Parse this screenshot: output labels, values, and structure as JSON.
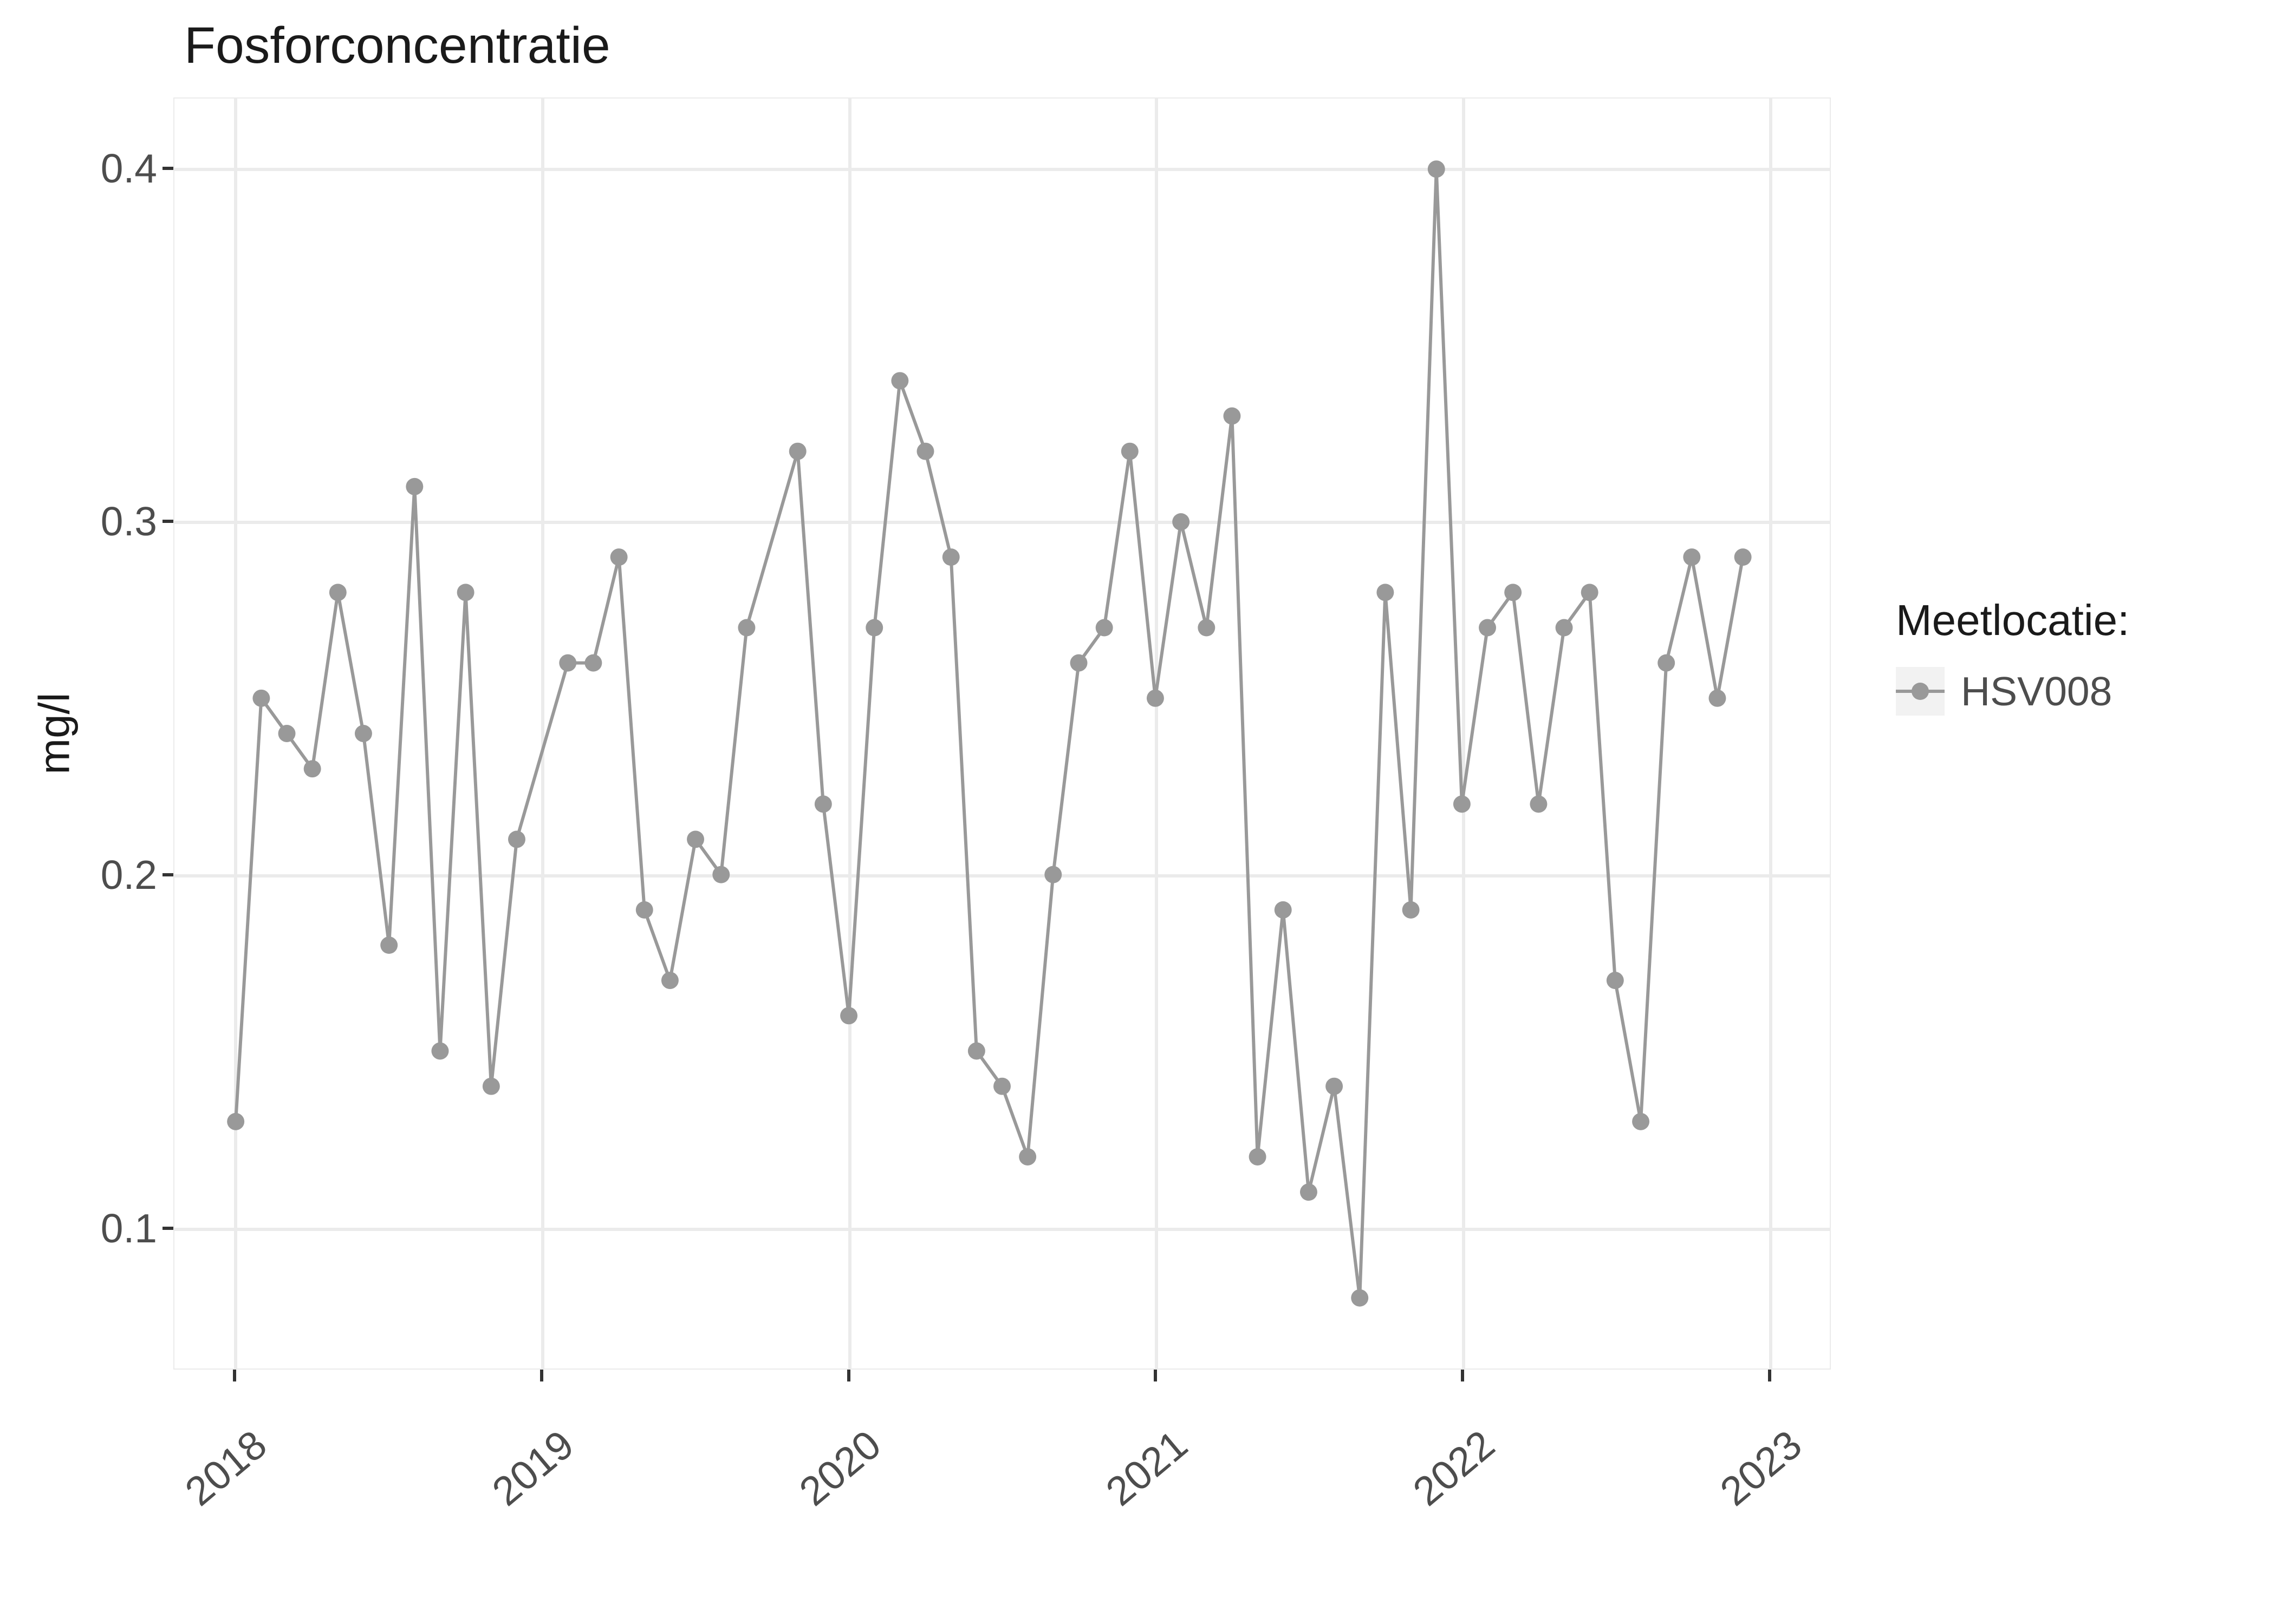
{
  "chart_data": {
    "type": "line",
    "title": "Fosforconcentratie",
    "xlabel": "",
    "ylabel": "mg/l",
    "xlim": [
      0,
      60
    ],
    "ylim": [
      0.06,
      0.42
    ],
    "y_ticks": [
      0.1,
      0.2,
      0.3,
      0.4
    ],
    "x_ticks": [
      {
        "x": 0,
        "label": "2018"
      },
      {
        "x": 12,
        "label": "2019"
      },
      {
        "x": 24,
        "label": "2020"
      },
      {
        "x": 36,
        "label": "2021"
      },
      {
        "x": 48,
        "label": "2022"
      },
      {
        "x": 60,
        "label": "2023"
      }
    ],
    "legend": {
      "title": "Meetlocatie:",
      "items": [
        "HSV008"
      ]
    },
    "series": [
      {
        "name": "HSV008",
        "x": [
          0,
          1,
          2,
          3,
          4,
          5,
          6,
          7,
          8,
          9,
          10,
          11,
          13,
          14,
          15,
          16,
          17,
          18,
          19,
          20,
          22,
          23,
          24,
          25,
          26,
          27,
          28,
          29,
          30,
          31,
          32,
          33,
          34,
          35,
          36,
          37,
          38,
          39,
          40,
          41,
          42,
          43,
          44,
          45,
          46,
          47,
          48,
          49,
          50,
          51,
          52,
          53,
          54,
          55,
          56,
          57,
          58,
          59
        ],
        "values": [
          0.13,
          0.25,
          0.24,
          0.23,
          0.28,
          0.24,
          0.18,
          0.31,
          0.15,
          0.28,
          0.14,
          0.21,
          0.26,
          0.26,
          0.29,
          0.19,
          0.17,
          0.21,
          0.2,
          0.27,
          0.32,
          0.22,
          0.16,
          0.27,
          0.34,
          0.32,
          0.29,
          0.15,
          0.14,
          0.12,
          0.2,
          0.26,
          0.27,
          0.32,
          0.25,
          0.3,
          0.27,
          0.33,
          0.12,
          0.19,
          0.11,
          0.14,
          0.08,
          0.28,
          0.19,
          0.4,
          0.22,
          0.27,
          0.28,
          0.22,
          0.27,
          0.28,
          0.17,
          0.13,
          0.26,
          0.29,
          0.25,
          0.29
        ]
      }
    ]
  }
}
